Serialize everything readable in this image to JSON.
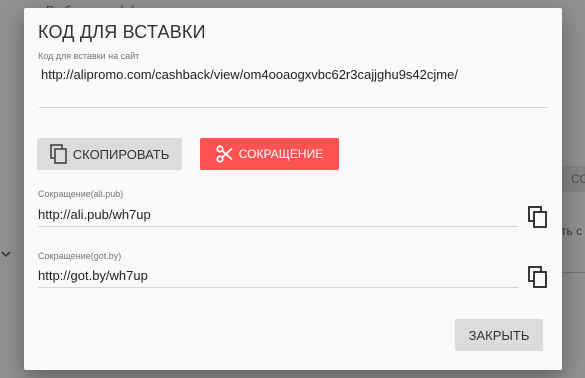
{
  "background": {
    "top_text": "Выберите оффер",
    "right_strip_text": "CO",
    "right_text": "ть с"
  },
  "modal": {
    "title": "КОД ДЛЯ ВСТАВКИ",
    "embed": {
      "label": "Код для вставки на сайт",
      "value": "http://alipromo.com/cashback/view/om4ooaogxvbc62r3cajjghu9s42cjme/"
    },
    "buttons": {
      "copy_label": "СКОПИРОВАТЬ",
      "shorten_label": "СОКРАЩЕНИЕ",
      "close_label": "ЗАКРЫТЬ"
    },
    "short_links": [
      {
        "label": "Сокращение(ali.pub)",
        "value": "http://ali.pub/wh7up"
      },
      {
        "label": "Сокращение(got.by)",
        "value": "http://got.by/wh7up"
      }
    ]
  },
  "colors": {
    "accent": "#ff5252",
    "button_gray": "#dcdcdc"
  },
  "icons": [
    "copy-icon",
    "scissors-icon",
    "chevron-down-icon"
  ]
}
